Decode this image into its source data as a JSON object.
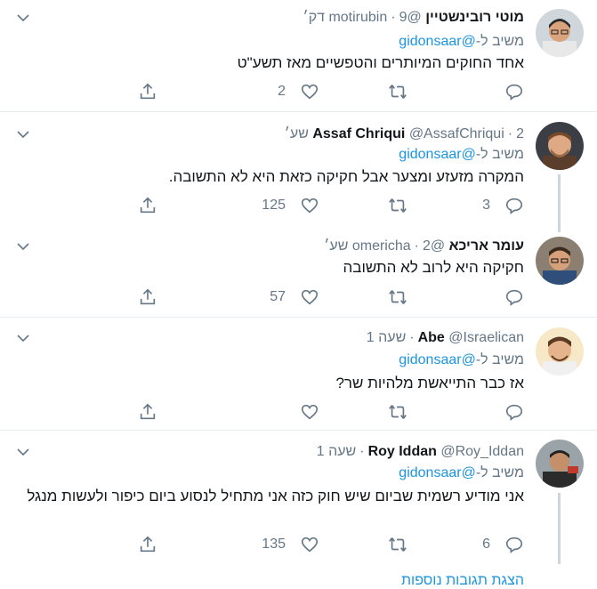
{
  "tweets": [
    {
      "name": "מוטי רובינשטיין",
      "handle": "@motirubin",
      "time": "9 דק׳",
      "replying_prefix": "משיב ל-",
      "replying_to": "@gidonsaar",
      "text": "אחד החוקים המיותרים והטפשיים מאז תשע\"ט",
      "reply_count": "",
      "like_count": "2",
      "avatar": {
        "skin": "#d9a37c",
        "hair": "#2b2b2b",
        "shirt": "#e8e8e8",
        "bg": "#cfd6dc"
      }
    },
    {
      "name": "Assaf Chriqui",
      "handle": "@AssafChriqui",
      "time": "2 שע׳",
      "replying_prefix": "משיב ל-",
      "replying_to": "@gidonsaar",
      "text": "המקרה מזעזע ומצער אבל חקיקה כזאת היא לא התשובה.",
      "reply_count": "3",
      "like_count": "125",
      "avatar": {
        "skin": "#e0a985",
        "hair": "#7a4a28",
        "shirt": "#5a3d2b",
        "bg": "#3b3f45"
      }
    },
    {
      "name": "עומר אריכא",
      "handle": "@omericha",
      "time": "2 שע׳",
      "replying_prefix": "",
      "replying_to": "",
      "text": "חקיקה היא לרוב לא התשובה",
      "reply_count": "",
      "like_count": "57",
      "avatar": {
        "skin": "#d6a07a",
        "hair": "#3a2a1e",
        "shirt": "#2f4f7a",
        "bg": "#8a7f70"
      }
    },
    {
      "name": "Abe",
      "handle": "@Israelican",
      "time": "שעה 1",
      "replying_prefix": "משיב ל-",
      "replying_to": "@gidonsaar",
      "text": "אז כבר התייאשת מלהיות שר?",
      "reply_count": "",
      "like_count": "",
      "avatar": {
        "skin": "#e6b48c",
        "hair": "#5b3b22",
        "shirt": "#f0f0f0",
        "bg": "#f7e9c8"
      }
    },
    {
      "name": "Roy Iddan",
      "handle": "@Roy_Iddan",
      "time": "שעה 1",
      "replying_prefix": "משיב ל-",
      "replying_to": "@gidonsaar",
      "text": "אני מודיע רשמית שביום שיש חוק כזה אני מתחיל לנסוע ביום כיפור ולעשות מנגל",
      "reply_count": "6",
      "like_count": "135",
      "avatar": {
        "skin": "#c58f6a",
        "hair": "#222222",
        "shirt": "#2b2b2b",
        "bg": "#9aa3a8"
      }
    }
  ],
  "bottom_link": "הצגת תגובות נוספות",
  "icons": {
    "reply": "reply-icon",
    "retweet": "retweet-icon",
    "like": "like-icon",
    "share": "share-icon",
    "caret": "chevron-down-icon"
  },
  "colors": {
    "text": "#14171a",
    "secondary": "#657786",
    "link": "#1b95e0",
    "separator": "#e6ecf0",
    "thread_line": "#ccd6dd"
  }
}
